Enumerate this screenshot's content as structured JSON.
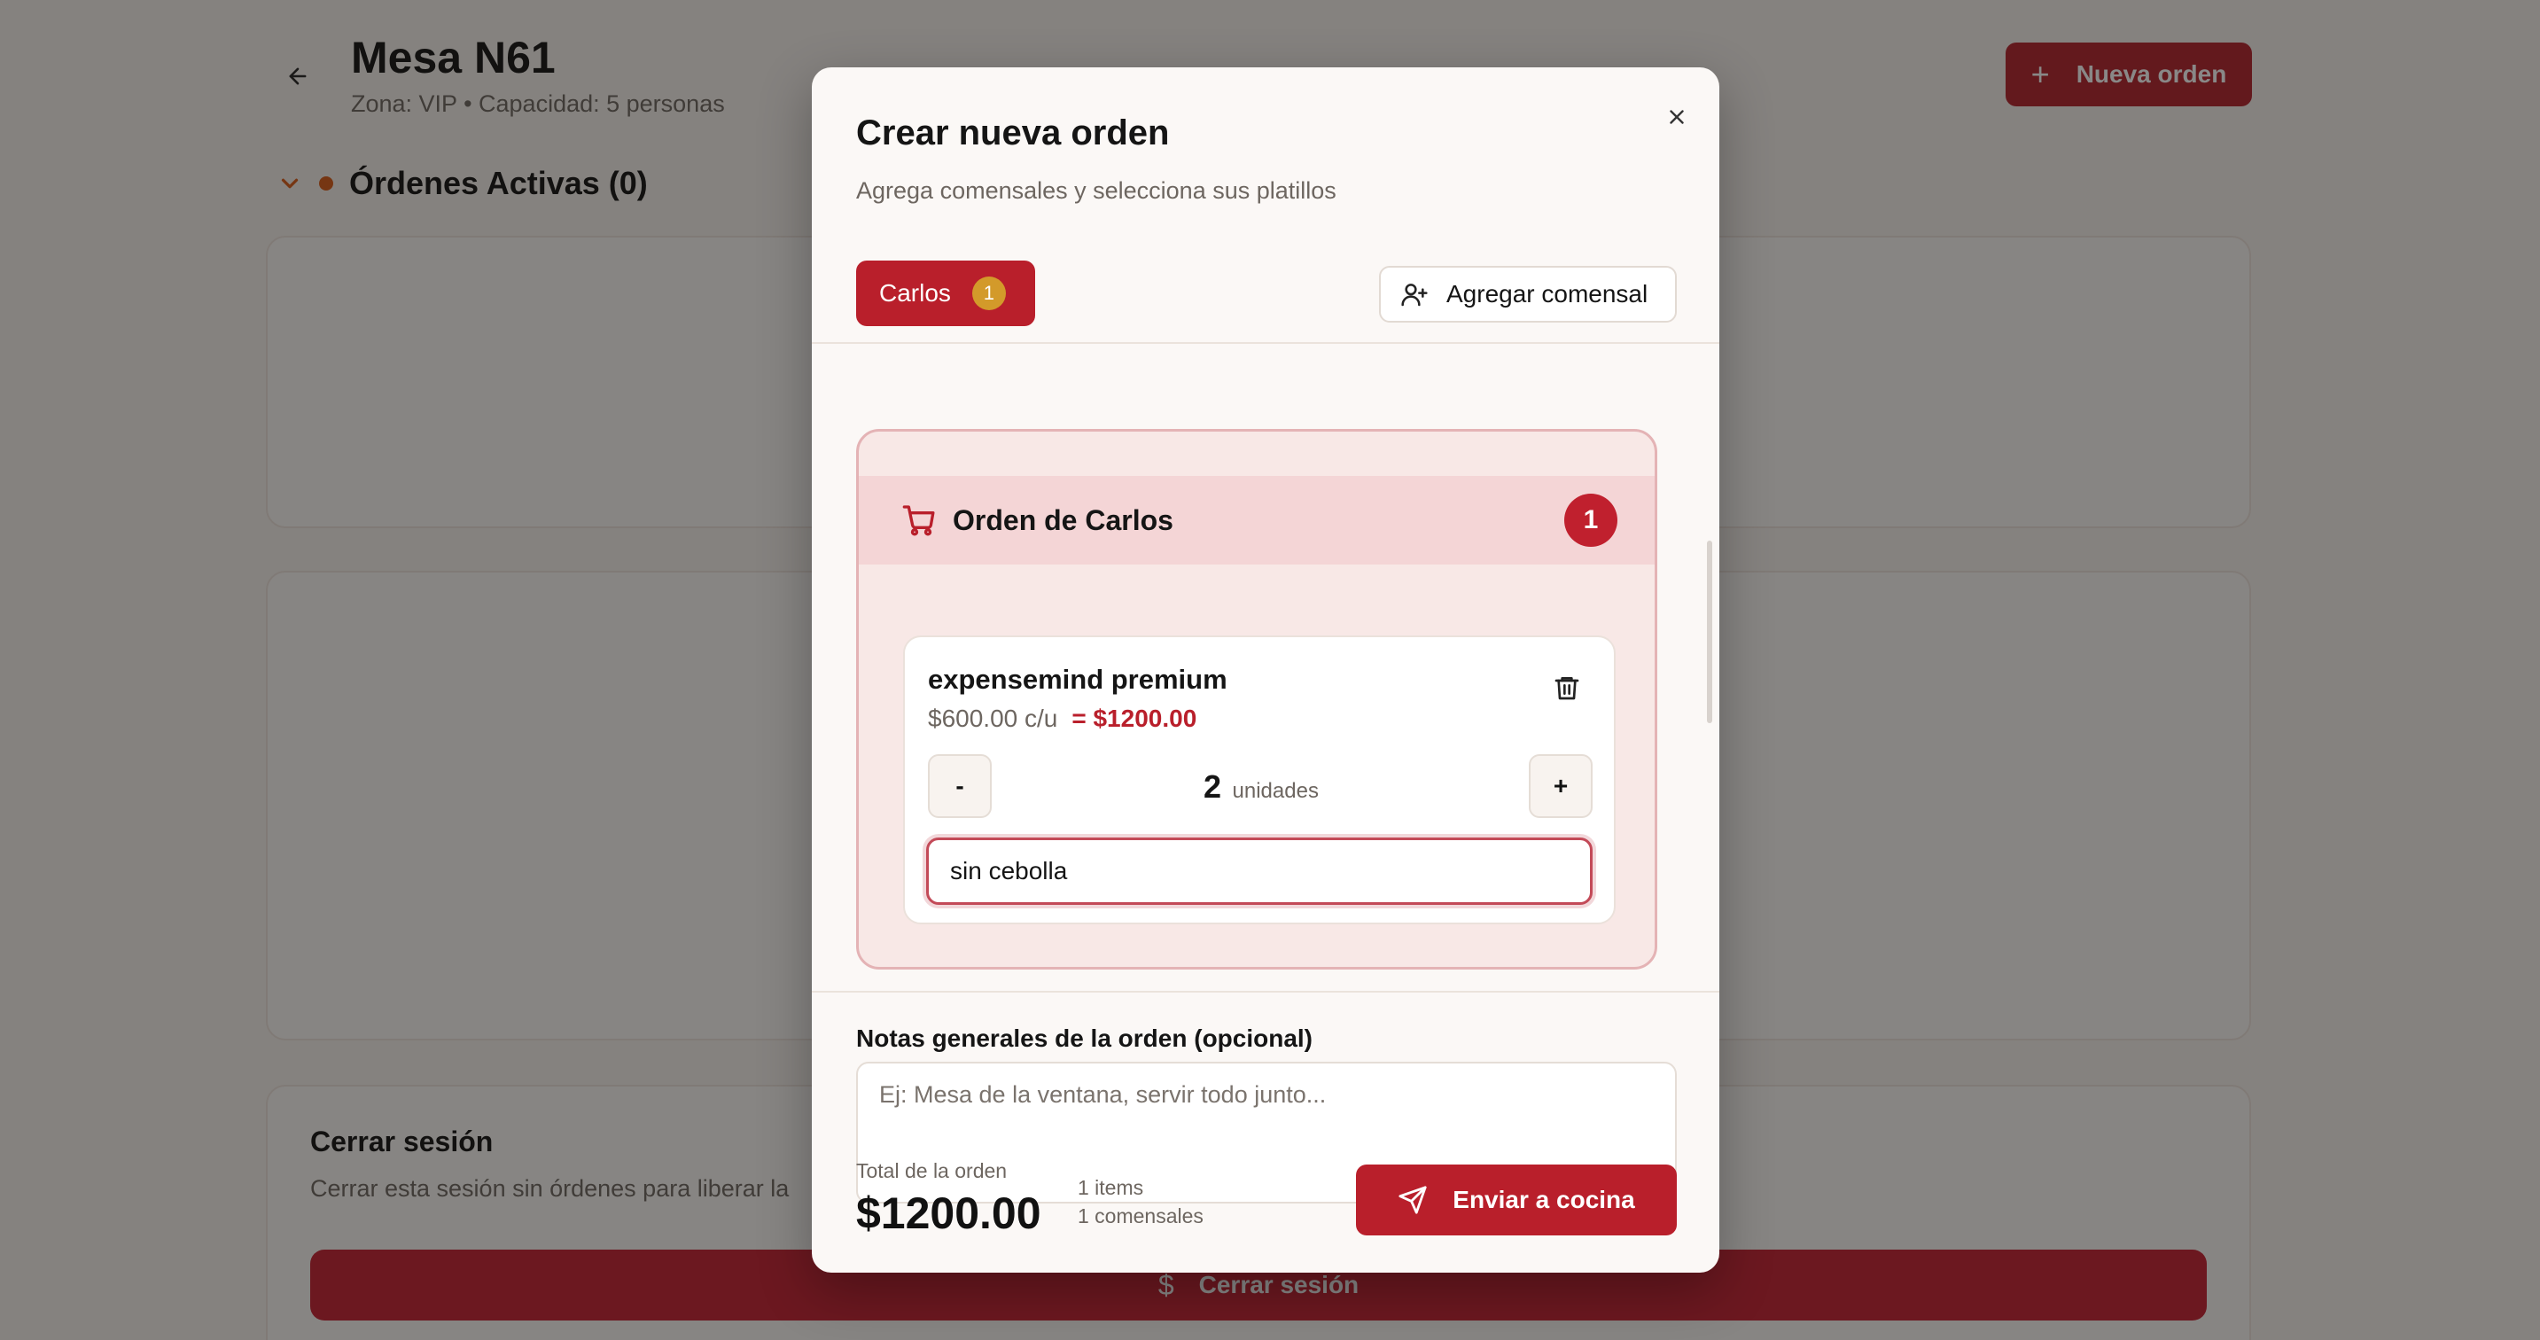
{
  "page": {
    "title": "Mesa N61",
    "subtitle": "Zona: VIP • Capacidad: 5 personas",
    "new_order_label": "Nueva orden",
    "active_orders_heading": "Órdenes Activas (0)",
    "logout": {
      "title": "Cerrar sesión",
      "description": "Cerrar esta sesión sin órdenes para liberar la",
      "button_label": "Cerrar sesión"
    }
  },
  "modal": {
    "title": "Crear nueva orden",
    "description": "Agrega comensales y selecciona sus platillos",
    "diners": [
      {
        "name": "Carlos",
        "count": "1"
      }
    ],
    "add_diner_label": "Agregar comensal",
    "order": {
      "title": "Orden de Carlos",
      "count": "1",
      "items": [
        {
          "name": "expensemind premium",
          "unit_price": "$600.00 c/u",
          "line_total": "= $1200.00",
          "quantity": "2",
          "quantity_unit": "unidades",
          "notes_value": "sin cebolla",
          "minus_label": "-",
          "plus_label": "+"
        }
      ]
    },
    "general_notes": {
      "label": "Notas generales de la orden (opcional)",
      "placeholder": "Ej: Mesa de la ventana, servir todo junto..."
    },
    "footer": {
      "total_label": "Total de la orden",
      "total_value": "$1200.00",
      "items_count": "1 items",
      "diners_count": "1 comensales",
      "send_label": "Enviar a cocina"
    }
  },
  "colors": {
    "primary": "#b91f2b",
    "badge_gold": "#d39a2a",
    "accent_orange": "#d95b16"
  }
}
